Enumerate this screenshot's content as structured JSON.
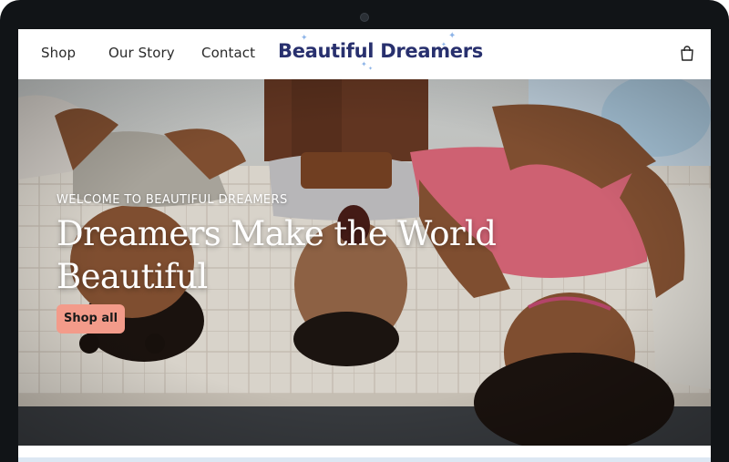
{
  "header": {
    "nav": [
      {
        "label": "Shop"
      },
      {
        "label": "Our Story"
      },
      {
        "label": "Contact"
      }
    ],
    "logo_text": "Beautiful Dreamers",
    "cart_icon": "shopping-bag-icon"
  },
  "hero": {
    "eyebrow": "WELCOME TO BEAUTIFUL DREAMERS",
    "title": "Dreamers Make the World Beautiful",
    "cta_label": "Shop all"
  },
  "colors": {
    "logo_text": "#28306e",
    "moon": "#f39b8a",
    "sparkle": "#8db4e8",
    "cta_bg": "#f39b8a",
    "bezel": "#111417"
  }
}
